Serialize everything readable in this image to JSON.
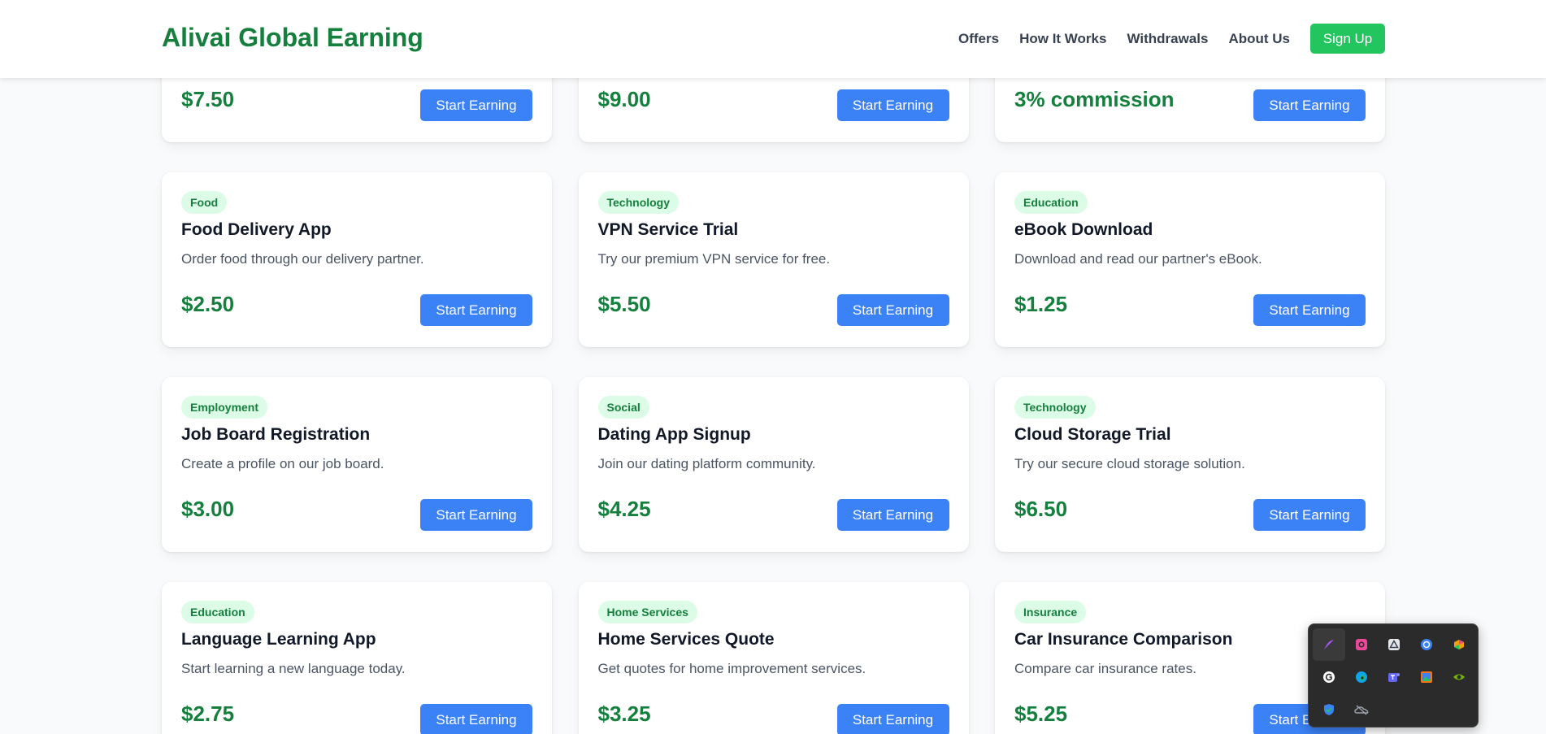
{
  "header": {
    "brand": "Alivai Global Earning",
    "nav": [
      "Offers",
      "How It Works",
      "Withdrawals",
      "About Us"
    ],
    "signup_label": "Sign Up"
  },
  "offers": [
    {
      "price": "$7.50",
      "button": "Start Earning"
    },
    {
      "price": "$9.00",
      "button": "Start Earning"
    },
    {
      "price": "3% commission",
      "button": "Start Earning"
    },
    {
      "category": "Food",
      "title": "Food Delivery App",
      "description": "Order food through our delivery partner.",
      "price": "$2.50",
      "button": "Start Earning"
    },
    {
      "category": "Technology",
      "title": "VPN Service Trial",
      "description": "Try our premium VPN service for free.",
      "price": "$5.50",
      "button": "Start Earning"
    },
    {
      "category": "Education",
      "title": "eBook Download",
      "description": "Download and read our partner's eBook.",
      "price": "$1.25",
      "button": "Start Earning"
    },
    {
      "category": "Employment",
      "title": "Job Board Registration",
      "description": "Create a profile on our job board.",
      "price": "$3.00",
      "button": "Start Earning"
    },
    {
      "category": "Social",
      "title": "Dating App Signup",
      "description": "Join our dating platform community.",
      "price": "$4.25",
      "button": "Start Earning"
    },
    {
      "category": "Technology",
      "title": "Cloud Storage Trial",
      "description": "Try our secure cloud storage solution.",
      "price": "$6.50",
      "button": "Start Earning"
    },
    {
      "category": "Education",
      "title": "Language Learning App",
      "description": "Start learning a new language today.",
      "price": "$2.75",
      "button": "Start Earning"
    },
    {
      "category": "Home Services",
      "title": "Home Services Quote",
      "description": "Get quotes for home improvement services.",
      "price": "$3.25",
      "button": "Start Earning"
    },
    {
      "category": "Insurance",
      "title": "Car Insurance Comparison",
      "description": "Compare car insurance rates.",
      "price": "$5.25",
      "button": "Start Earning"
    }
  ],
  "tray": {
    "icons": [
      {
        "name": "feather-app-icon",
        "color": "#a855f7"
      },
      {
        "name": "screen-recorder-icon",
        "color": "#ec4899"
      },
      {
        "name": "google-drive-icon",
        "color": "#e5e7eb"
      },
      {
        "name": "sync-app-icon",
        "color": "#3b82f6"
      },
      {
        "name": "copilot-icon",
        "color": "#f59e0b"
      },
      {
        "name": "grammarly-icon",
        "color": "#ffffff"
      },
      {
        "name": "edge-browser-icon",
        "color": "#0ea5e9"
      },
      {
        "name": "teams-icon",
        "color": "#6366f1"
      },
      {
        "name": "photos-app-icon",
        "color": "#f97316"
      },
      {
        "name": "nvidia-icon",
        "color": "#76b900"
      },
      {
        "name": "windows-security-icon",
        "color": "#3b82f6"
      },
      {
        "name": "onedrive-offline-icon",
        "color": "#9ca3af"
      }
    ]
  },
  "colors": {
    "brand_green": "#15803d",
    "button_blue": "#3b82f6",
    "signup_green": "#22c55e",
    "badge_bg": "#dcfce7"
  }
}
